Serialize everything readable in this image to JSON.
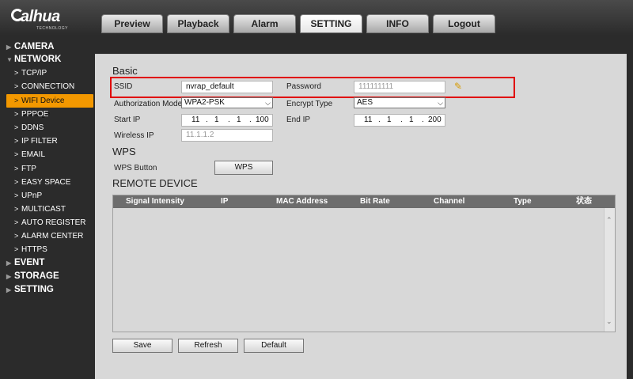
{
  "logo": {
    "brand": "alhua",
    "sub": "TECHNOLOGY"
  },
  "tabs": [
    {
      "label": "Preview"
    },
    {
      "label": "Playback"
    },
    {
      "label": "Alarm"
    },
    {
      "label": "SETTING"
    },
    {
      "label": "INFO"
    },
    {
      "label": "Logout"
    }
  ],
  "sidebar": {
    "camera": "CAMERA",
    "network": "NETWORK",
    "items": [
      "TCP/IP",
      "CONNECTION",
      "WIFI Device Manage",
      "PPPOE",
      "DDNS",
      "IP FILTER",
      "EMAIL",
      "FTP",
      "EASY SPACE",
      "UPnP",
      "MULTICAST",
      "AUTO REGISTER",
      "ALARM CENTER",
      "HTTPS"
    ],
    "event": "EVENT",
    "storage": "STORAGE",
    "setting": "SETTING"
  },
  "basic": {
    "title": "Basic",
    "ssid_label": "SSID",
    "ssid_value": "nvrap_default",
    "password_label": "Password",
    "password_value": "111111111",
    "auth_label": "Authorization Mode",
    "auth_value": "WPA2-PSK",
    "encrypt_label": "Encrypt Type",
    "encrypt_value": "AES",
    "start_ip_label": "Start IP",
    "start_ip": [
      "11",
      "1",
      "1",
      "100"
    ],
    "end_ip_label": "End IP",
    "end_ip": [
      "11",
      "1",
      "1",
      "200"
    ],
    "wireless_ip_label": "Wireless IP",
    "wireless_ip_value": "11.1.1.2"
  },
  "wps": {
    "title": "WPS",
    "button_label": "WPS Button",
    "button": "WPS"
  },
  "remote": {
    "title": "REMOTE DEVICE",
    "columns": [
      "Signal Intensity",
      "IP",
      "MAC Address",
      "Bit Rate",
      "Channel",
      "Type",
      "状态"
    ]
  },
  "actions": {
    "save": "Save",
    "refresh": "Refresh",
    "default": "Default"
  }
}
